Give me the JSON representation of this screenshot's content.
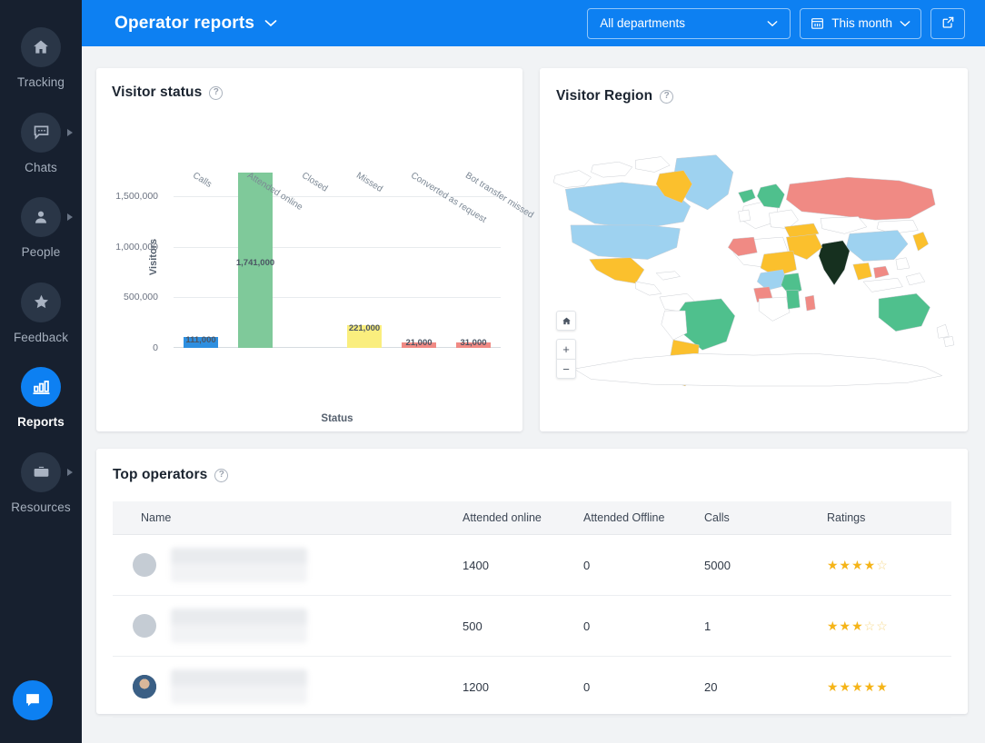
{
  "sidebar": {
    "items": [
      {
        "label": "Tracking",
        "icon": "home-icon",
        "active": false,
        "caret": false
      },
      {
        "label": "Chats",
        "icon": "chat-icon",
        "active": false,
        "caret": true
      },
      {
        "label": "People",
        "icon": "person-icon",
        "active": false,
        "caret": true
      },
      {
        "label": "Feedback",
        "icon": "star-icon",
        "active": false,
        "caret": false
      },
      {
        "label": "Reports",
        "icon": "bar-chart-icon",
        "active": true,
        "caret": false
      },
      {
        "label": "Resources",
        "icon": "briefcase-icon",
        "active": false,
        "caret": true
      }
    ],
    "fab": "chat-bubble-icon"
  },
  "header": {
    "title": "Operator reports",
    "title_caret": "chevron-down-icon",
    "department_filter": "All departments",
    "date_filter": "This month",
    "date_icon": "calendar-icon",
    "export_icon": "external-link-icon",
    "accent_color": "#0d80f2"
  },
  "visitor_status": {
    "title": "Visitor status",
    "help": "?"
  },
  "visitor_region": {
    "title": "Visitor Region",
    "help": "?",
    "controls": {
      "home": "home-icon",
      "zoom_in": "+",
      "zoom_out": "−"
    }
  },
  "top_operators": {
    "title": "Top operators",
    "help": "?",
    "columns": [
      "Name",
      "Attended online",
      "Attended Offline",
      "Calls",
      "Ratings"
    ],
    "rows": [
      {
        "name": "",
        "attended_online": "1400",
        "attended_offline": "0",
        "calls": "5000",
        "rating_filled": 4,
        "rating_total": 5,
        "avatar": "redacted-avatar"
      },
      {
        "name": "",
        "attended_online": "500",
        "attended_offline": "0",
        "calls": "1",
        "rating_filled": 3,
        "rating_total": 5,
        "avatar": "redacted-avatar"
      },
      {
        "name": "",
        "attended_online": "1200",
        "attended_offline": "0",
        "calls": "20",
        "rating_filled": 5,
        "rating_total": 5,
        "avatar": "photo-avatar"
      }
    ]
  },
  "chart_data": {
    "type": "bar",
    "title": "Visitor status",
    "xlabel": "Status",
    "ylabel": "Visitors",
    "categories": [
      "Calls",
      "Attended online",
      "Closed",
      "Missed",
      "Converted as request",
      "Bot transfer missed"
    ],
    "values": [
      111000,
      1741000,
      0,
      221000,
      21000,
      31000
    ],
    "value_labels": [
      "111,000",
      "1,741,000",
      "",
      "221,000",
      "21,000",
      "31,000"
    ],
    "colors": [
      "#2e8fe0",
      "#7fc99a",
      "#e8eaec",
      "#faee7e",
      "#f08a84",
      "#f08a84"
    ],
    "ylim": [
      0,
      1800000
    ],
    "yticks": [
      0,
      500000,
      1000000,
      1500000
    ],
    "ytick_labels": [
      "0",
      "500,000",
      "1,000,000",
      "1,500,000"
    ],
    "grid": true,
    "legend": "none"
  }
}
